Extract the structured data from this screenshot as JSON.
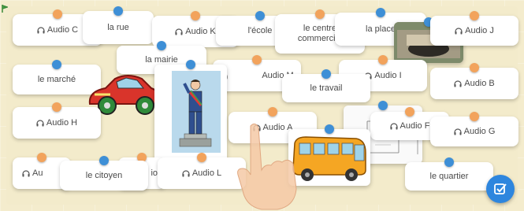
{
  "cards": {
    "audio_c": "Audio C",
    "la_rue": "la rue",
    "audio_k": "Audio K",
    "l_ecole": "l'école",
    "le_centre_commercial": "le centre commercial",
    "la_place": "la place",
    "audio_j": "Audio J",
    "la_mairie": "la mairie",
    "le_marche": "le marché",
    "audio_m": "Audio M",
    "audio_i": "Audio I",
    "le_travail": "le travail",
    "audio_b": "Audio B",
    "audio_h": "Audio H",
    "audio_a": "Audio A",
    "audio_f": "Audio F",
    "audio_g": "Audio G",
    "audio_e_partial": "Au",
    "le_citoyen": "le citoyen",
    "partial_io": "io",
    "audio_l": "Audio L",
    "le_quartier": "le quartier"
  },
  "icons": {
    "audio": "headphones-icon",
    "check": "check-edit-icon",
    "pointer": "hand-pointer-icon"
  },
  "colors": {
    "board": "#f3ebcb",
    "pin_orange": "#f2a35c",
    "pin_blue": "#3e8fd6",
    "check_button": "#2e86de"
  }
}
